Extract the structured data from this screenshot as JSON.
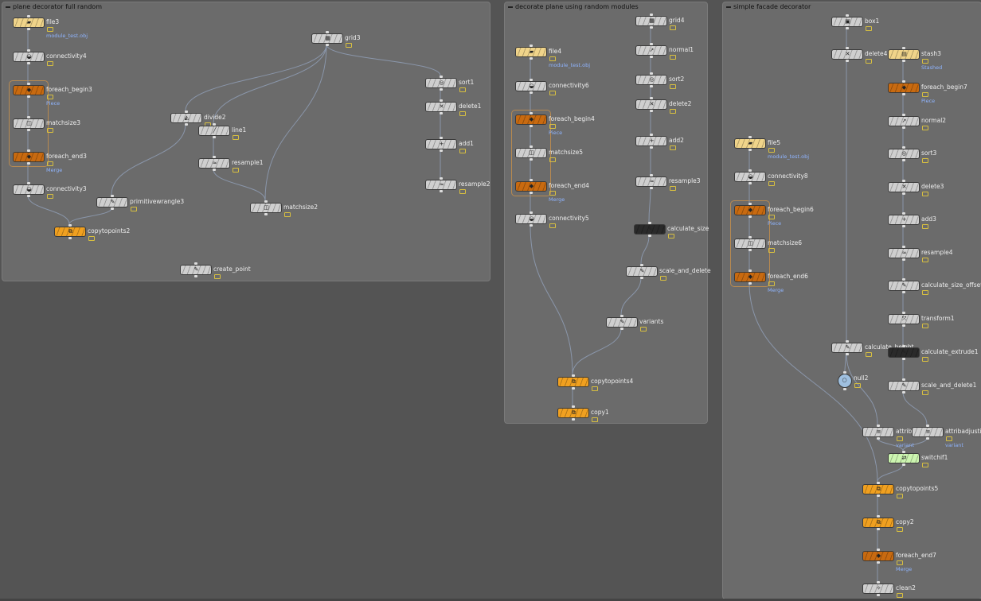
{
  "boxes": [
    {
      "title": "plane decorator full random"
    },
    {
      "title": "decorate plane using random modules"
    },
    {
      "title": "simple facade decorator"
    }
  ],
  "nodes": [
    {
      "label": "file3",
      "sub": "module_test.obj",
      "color": "yellow",
      "icon": "file-icon"
    },
    {
      "label": "connectivity4",
      "sub": "",
      "color": "gray",
      "icon": "connectivity-icon"
    },
    {
      "label": "foreach_begin3",
      "sub": "Piece",
      "color": "dkorange",
      "icon": "foreach-icon"
    },
    {
      "label": "matchsize3",
      "sub": "",
      "color": "gray",
      "icon": "matchsize-icon"
    },
    {
      "label": "foreach_end3",
      "sub": "Merge",
      "color": "dkorange",
      "icon": "foreach-icon"
    },
    {
      "label": "connectivity3",
      "sub": "",
      "color": "gray",
      "icon": "connectivity-icon"
    },
    {
      "label": "primitivewrangle3",
      "sub": "",
      "color": "gray",
      "icon": "wrangle-icon"
    },
    {
      "label": "copytopoints2",
      "sub": "",
      "color": "orange",
      "icon": "copy-icon"
    },
    {
      "label": "grid3",
      "sub": "",
      "color": "gray",
      "icon": "grid-icon"
    },
    {
      "label": "divide2",
      "sub": "",
      "color": "gray",
      "icon": "divide-icon"
    },
    {
      "label": "line1",
      "sub": "",
      "color": "gray",
      "icon": "line-icon"
    },
    {
      "label": "resample1",
      "sub": "",
      "color": "gray",
      "icon": "resample-icon"
    },
    {
      "label": "matchsize2",
      "sub": "",
      "color": "gray",
      "icon": "matchsize-icon"
    },
    {
      "label": "sort1",
      "sub": "",
      "color": "gray",
      "icon": "sort-icon"
    },
    {
      "label": "delete1",
      "sub": "",
      "color": "gray",
      "icon": "delete-icon"
    },
    {
      "label": "add1",
      "sub": "",
      "color": "gray",
      "icon": "add-icon"
    },
    {
      "label": "resample2",
      "sub": "",
      "color": "gray",
      "icon": "resample-icon"
    },
    {
      "label": "create_point",
      "sub": "",
      "color": "gray",
      "icon": "wrangle-icon"
    },
    {
      "label": "file4",
      "sub": "module_test.obj",
      "color": "yellow",
      "icon": "file-icon"
    },
    {
      "label": "connectivity6",
      "sub": "",
      "color": "gray",
      "icon": "connectivity-icon"
    },
    {
      "label": "foreach_begin4",
      "sub": "Piece",
      "color": "dkorange",
      "icon": "foreach-icon"
    },
    {
      "label": "matchsize5",
      "sub": "",
      "color": "gray",
      "icon": "matchsize-icon"
    },
    {
      "label": "foreach_end4",
      "sub": "Merge",
      "color": "dkorange",
      "icon": "foreach-icon"
    },
    {
      "label": "connectivity5",
      "sub": "",
      "color": "gray",
      "icon": "connectivity-icon"
    },
    {
      "label": "grid4",
      "sub": "",
      "color": "gray",
      "icon": "grid-icon"
    },
    {
      "label": "normal1",
      "sub": "",
      "color": "gray",
      "icon": "normal-icon"
    },
    {
      "label": "sort2",
      "sub": "",
      "color": "gray",
      "icon": "sort-icon"
    },
    {
      "label": "delete2",
      "sub": "",
      "color": "gray",
      "icon": "delete-icon"
    },
    {
      "label": "add2",
      "sub": "",
      "color": "gray",
      "icon": "add-icon"
    },
    {
      "label": "resample3",
      "sub": "",
      "color": "gray",
      "icon": "resample-icon"
    },
    {
      "label": "calculate_size",
      "sub": "",
      "color": "dark",
      "icon": "wrangle-icon"
    },
    {
      "label": "scale_and_delete",
      "sub": "",
      "color": "gray",
      "icon": "wrangle-icon"
    },
    {
      "label": "variants",
      "sub": "",
      "color": "gray",
      "icon": "wrangle-icon"
    },
    {
      "label": "copytopoints4",
      "sub": "",
      "color": "orange",
      "icon": "copy-icon"
    },
    {
      "label": "copy1",
      "sub": "",
      "color": "orange",
      "icon": "copy-icon"
    },
    {
      "label": "box1",
      "sub": "",
      "color": "gray",
      "icon": "box-icon"
    },
    {
      "label": "delete4",
      "sub": "",
      "color": "gray",
      "icon": "delete-icon"
    },
    {
      "label": "stash3",
      "sub": "Stashed",
      "color": "yellow",
      "icon": "stash-icon"
    },
    {
      "label": "foreach_begin7",
      "sub": "Piece",
      "color": "dkorange",
      "icon": "foreach-icon"
    },
    {
      "label": "normal2",
      "sub": "",
      "color": "gray",
      "icon": "normal-icon"
    },
    {
      "label": "sort3",
      "sub": "",
      "color": "gray",
      "icon": "sort-icon"
    },
    {
      "label": "delete3",
      "sub": "",
      "color": "gray",
      "icon": "delete-icon"
    },
    {
      "label": "add3",
      "sub": "",
      "color": "gray",
      "icon": "add-icon"
    },
    {
      "label": "resample4",
      "sub": "",
      "color": "gray",
      "icon": "resample-icon"
    },
    {
      "label": "calculate_size_offset",
      "sub": "",
      "color": "gray",
      "icon": "wrangle-icon"
    },
    {
      "label": "transform1",
      "sub": "",
      "color": "gray",
      "icon": "transform-icon"
    },
    {
      "label": "file5",
      "sub": "module_test.obj",
      "color": "yellow",
      "icon": "file-icon"
    },
    {
      "label": "connectivity8",
      "sub": "",
      "color": "gray",
      "icon": "connectivity-icon"
    },
    {
      "label": "foreach_begin6",
      "sub": "Piece",
      "color": "dkorange",
      "icon": "foreach-icon"
    },
    {
      "label": "matchsize6",
      "sub": "",
      "color": "gray",
      "icon": "matchsize-icon"
    },
    {
      "label": "foreach_end6",
      "sub": "Merge",
      "color": "dkorange",
      "icon": "foreach-icon"
    },
    {
      "label": "calculate_height",
      "sub": "",
      "color": "gray",
      "icon": "wrangle-icon"
    },
    {
      "label": "calculate_extrude1",
      "sub": "",
      "color": "dark",
      "icon": "wrangle-icon"
    },
    {
      "label": "null2",
      "sub": "",
      "color": "round",
      "icon": "null-icon"
    },
    {
      "label": "scale_and_delete1",
      "sub": "",
      "color": "gray",
      "icon": "wrangle-icon"
    },
    {
      "label": "attrib",
      "sub": "variant",
      "color": "gray",
      "icon": "attrib-icon"
    },
    {
      "label": "attribadjustint",
      "sub": "variant",
      "color": "gray",
      "icon": "attrib-icon"
    },
    {
      "label": "switchif1",
      "sub": "",
      "color": "green",
      "icon": "switch-icon"
    },
    {
      "label": "copytopoints5",
      "sub": "",
      "color": "orange",
      "icon": "copy-icon"
    },
    {
      "label": "copy2",
      "sub": "",
      "color": "orange",
      "icon": "copy-icon"
    },
    {
      "label": "foreach_end7",
      "sub": "Merge",
      "color": "dkorange",
      "icon": "foreach-icon"
    },
    {
      "label": "clean2",
      "sub": "",
      "color": "gray",
      "icon": "clean-icon"
    }
  ],
  "colors": {
    "background": "#545454",
    "netbox": "#6b6b6b",
    "wire": "#8a96aa",
    "label": "#eeeeee",
    "sublabel": "#8fb4ff",
    "foreach": "#c86a10",
    "copy": "#f0a020",
    "file": "#f0d48a"
  }
}
